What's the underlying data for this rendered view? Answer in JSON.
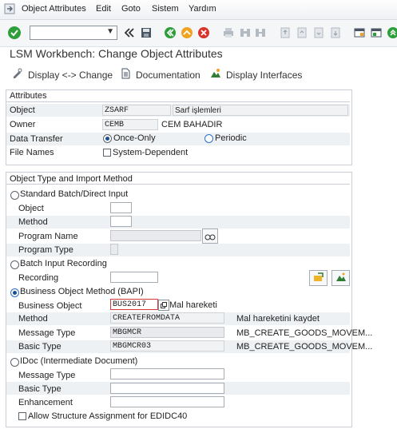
{
  "menu": {
    "items": [
      "Object Attributes",
      "Edit",
      "Goto",
      "Sistem",
      "Yardım"
    ]
  },
  "toolbar": {
    "command_value": "",
    "icons": [
      "check-icon",
      "back-double-icon",
      "save-icon",
      "back-icon",
      "exit-icon",
      "cancel-icon",
      "print-icon",
      "find-icon",
      "find-next-icon",
      "first-page-icon",
      "prev-page-icon",
      "next-page-icon",
      "last-page-icon",
      "create-session-icon",
      "help-icon"
    ]
  },
  "title": "LSM Workbench: Change Object Attributes",
  "app_toolbar": {
    "display_change": "Display <-> Change",
    "documentation": "Documentation",
    "display_interfaces": "Display Interfaces"
  },
  "attributes": {
    "group_title": "Attributes",
    "object_label": "Object",
    "object_value": "ZSARF",
    "object_desc": "Sarf işlemleri",
    "owner_label": "Owner",
    "owner_value": "CEMB",
    "owner_name": "CEM BAHADIR",
    "data_transfer_label": "Data Transfer",
    "once_only": "Once-Only",
    "periodic": "Periodic",
    "file_names_label": "File Names",
    "system_dependent": "System-Dependent"
  },
  "import_method": {
    "group_title": "Object Type and Import Method",
    "standard_batch": "Standard Batch/Direct Input",
    "sb_object": "Object",
    "sb_method": "Method",
    "sb_program_name": "Program Name",
    "sb_program_type": "Program Type",
    "batch_input": "Batch Input Recording",
    "recording": "Recording",
    "bapi": "Business Object Method  (BAPI)",
    "bapi_business_object": "Business Object",
    "bapi_business_object_value": "BUS2017",
    "bapi_business_object_desc": "Mal hareketi",
    "bapi_method": "Method",
    "bapi_method_value": "CREATEFROMDATA",
    "bapi_method_desc": "Mal hareketini kaydet",
    "bapi_message_type": "Message Type",
    "bapi_message_type_value": "MBGMCR",
    "bapi_message_type_desc": "MB_CREATE_GOODS_MOVEM...",
    "bapi_basic_type": "Basic Type",
    "bapi_basic_type_value": "MBGMCR03",
    "bapi_basic_type_desc": "MB_CREATE_GOODS_MOVEM...",
    "idoc": "IDoc (Intermediate Document)",
    "idoc_message_type": "Message Type",
    "idoc_basic_type": "Basic Type",
    "idoc_enhancement": "Enhancement",
    "allow_structure": "Allow Structure Assignment for EDIDC40"
  }
}
